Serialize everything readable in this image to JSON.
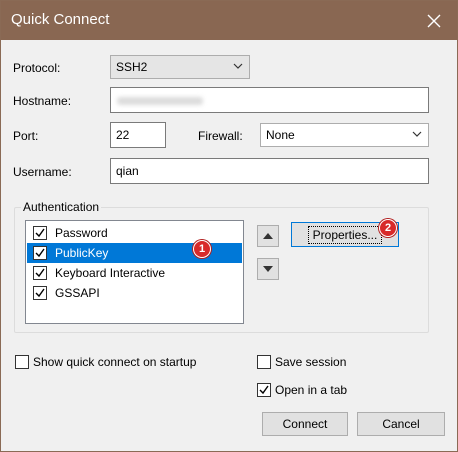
{
  "window": {
    "title": "Quick Connect"
  },
  "protocol": {
    "label": "Protocol:",
    "value": "SSH2"
  },
  "hostname": {
    "label": "Hostname:",
    "value": ""
  },
  "port": {
    "label": "Port:",
    "value": "22"
  },
  "firewall": {
    "label": "Firewall:",
    "value": "None"
  },
  "username": {
    "label": "Username:",
    "value": "qian"
  },
  "authentication": {
    "label": "Authentication",
    "methods": [
      {
        "label": "Password",
        "checked": true,
        "selected": false
      },
      {
        "label": "PublicKey",
        "checked": true,
        "selected": true
      },
      {
        "label": "Keyboard Interactive",
        "checked": true,
        "selected": false
      },
      {
        "label": "GSSAPI",
        "checked": true,
        "selected": false
      }
    ],
    "properties_label": "Properties..."
  },
  "badges": {
    "one": "1",
    "two": "2"
  },
  "options": {
    "show_quick_connect": {
      "label": "Show quick connect on startup",
      "checked": false
    },
    "save_session": {
      "label": "Save session",
      "checked": false
    },
    "open_in_tab": {
      "label": "Open in a tab",
      "checked": true
    }
  },
  "buttons": {
    "connect": "Connect",
    "cancel": "Cancel"
  },
  "colors": {
    "titlebar": "#896752",
    "selection": "#0078d7",
    "badge": "#d82a2a"
  }
}
